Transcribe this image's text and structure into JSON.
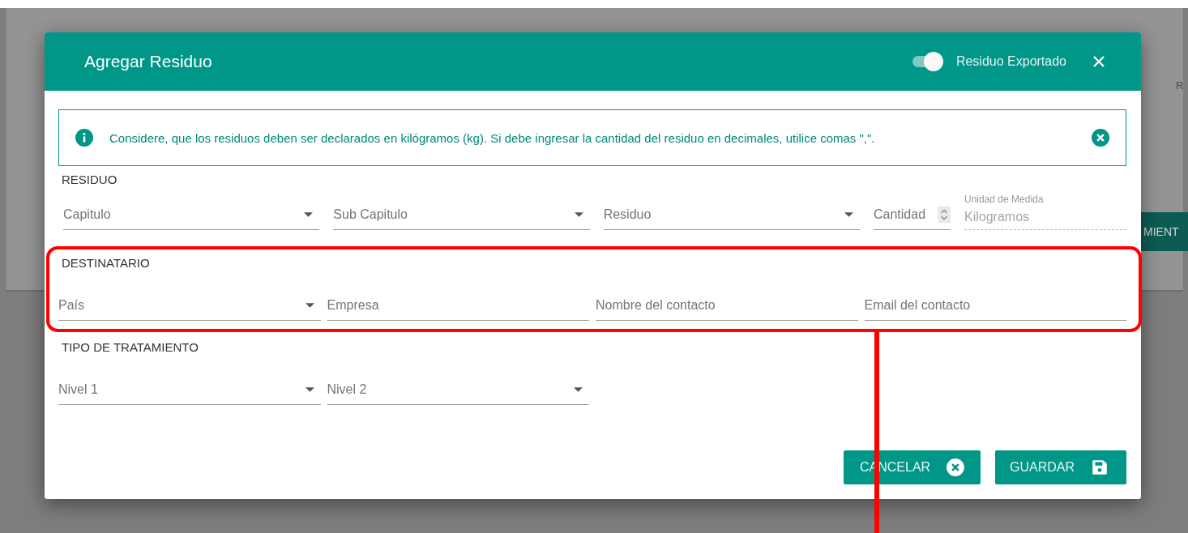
{
  "background": {
    "button_fragment": "MIENT",
    "label_fragment": "R"
  },
  "dialog": {
    "title": "Agregar Residuo",
    "export_toggle": {
      "label": "Residuo Exportado",
      "on": true
    }
  },
  "alert": {
    "text": "Considere, que los residuos deben ser declarados en kilógramos (kg). Si debe ingresar la cantidad del residuo en decimales, utilice comas \",\"."
  },
  "sections": [
    {
      "title": "RESIDUO",
      "fields": [
        {
          "kind": "select",
          "placeholder": "Capitulo"
        },
        {
          "kind": "select",
          "placeholder": "Sub Capitulo"
        },
        {
          "kind": "select",
          "placeholder": "Residuo"
        },
        {
          "kind": "number",
          "placeholder": "Cantidad"
        },
        {
          "kind": "readonly",
          "label": "Unidad de Medida",
          "value": "Kilogramos"
        }
      ]
    },
    {
      "title": "DESTINATARIO",
      "fields": [
        {
          "kind": "select",
          "placeholder": "País"
        },
        {
          "kind": "text",
          "placeholder": "Empresa"
        },
        {
          "kind": "text",
          "placeholder": "Nombre del contacto"
        },
        {
          "kind": "text",
          "placeholder": "Email del contacto"
        }
      ]
    },
    {
      "title": "TIPO DE TRATAMIENTO",
      "fields": [
        {
          "kind": "select",
          "placeholder": "Nivel 1"
        },
        {
          "kind": "select",
          "placeholder": "Nivel 2"
        }
      ]
    }
  ],
  "buttons": [
    {
      "kind": "cancel",
      "label": "CANCELAR"
    },
    {
      "kind": "save",
      "label": "GUARDAR"
    }
  ]
}
